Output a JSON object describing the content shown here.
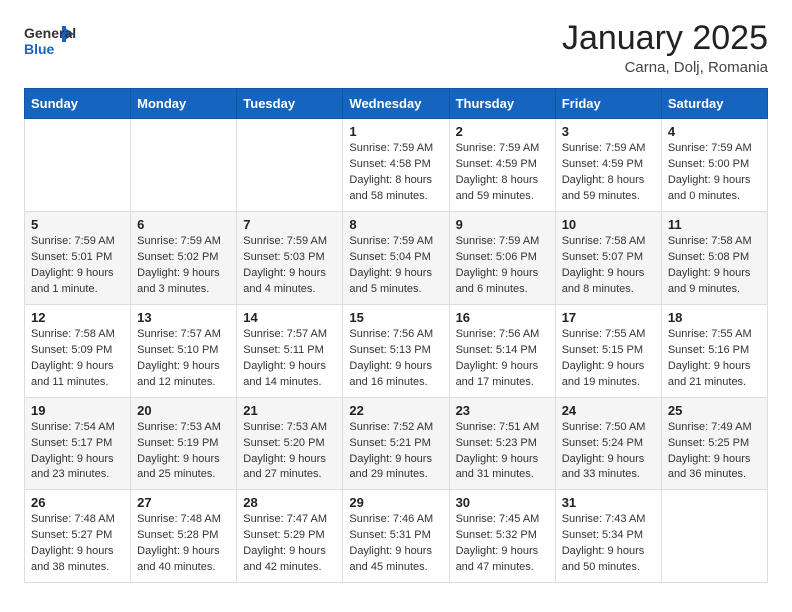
{
  "header": {
    "logo_general": "General",
    "logo_blue": "Blue",
    "month_year": "January 2025",
    "location": "Carna, Dolj, Romania"
  },
  "weekdays": [
    "Sunday",
    "Monday",
    "Tuesday",
    "Wednesday",
    "Thursday",
    "Friday",
    "Saturday"
  ],
  "weeks": [
    [
      {
        "day": "",
        "lines": []
      },
      {
        "day": "",
        "lines": []
      },
      {
        "day": "",
        "lines": []
      },
      {
        "day": "1",
        "lines": [
          "Sunrise: 7:59 AM",
          "Sunset: 4:58 PM",
          "Daylight: 8 hours",
          "and 58 minutes."
        ]
      },
      {
        "day": "2",
        "lines": [
          "Sunrise: 7:59 AM",
          "Sunset: 4:59 PM",
          "Daylight: 8 hours",
          "and 59 minutes."
        ]
      },
      {
        "day": "3",
        "lines": [
          "Sunrise: 7:59 AM",
          "Sunset: 4:59 PM",
          "Daylight: 8 hours",
          "and 59 minutes."
        ]
      },
      {
        "day": "4",
        "lines": [
          "Sunrise: 7:59 AM",
          "Sunset: 5:00 PM",
          "Daylight: 9 hours",
          "and 0 minutes."
        ]
      }
    ],
    [
      {
        "day": "5",
        "lines": [
          "Sunrise: 7:59 AM",
          "Sunset: 5:01 PM",
          "Daylight: 9 hours",
          "and 1 minute."
        ]
      },
      {
        "day": "6",
        "lines": [
          "Sunrise: 7:59 AM",
          "Sunset: 5:02 PM",
          "Daylight: 9 hours",
          "and 3 minutes."
        ]
      },
      {
        "day": "7",
        "lines": [
          "Sunrise: 7:59 AM",
          "Sunset: 5:03 PM",
          "Daylight: 9 hours",
          "and 4 minutes."
        ]
      },
      {
        "day": "8",
        "lines": [
          "Sunrise: 7:59 AM",
          "Sunset: 5:04 PM",
          "Daylight: 9 hours",
          "and 5 minutes."
        ]
      },
      {
        "day": "9",
        "lines": [
          "Sunrise: 7:59 AM",
          "Sunset: 5:06 PM",
          "Daylight: 9 hours",
          "and 6 minutes."
        ]
      },
      {
        "day": "10",
        "lines": [
          "Sunrise: 7:58 AM",
          "Sunset: 5:07 PM",
          "Daylight: 9 hours",
          "and 8 minutes."
        ]
      },
      {
        "day": "11",
        "lines": [
          "Sunrise: 7:58 AM",
          "Sunset: 5:08 PM",
          "Daylight: 9 hours",
          "and 9 minutes."
        ]
      }
    ],
    [
      {
        "day": "12",
        "lines": [
          "Sunrise: 7:58 AM",
          "Sunset: 5:09 PM",
          "Daylight: 9 hours",
          "and 11 minutes."
        ]
      },
      {
        "day": "13",
        "lines": [
          "Sunrise: 7:57 AM",
          "Sunset: 5:10 PM",
          "Daylight: 9 hours",
          "and 12 minutes."
        ]
      },
      {
        "day": "14",
        "lines": [
          "Sunrise: 7:57 AM",
          "Sunset: 5:11 PM",
          "Daylight: 9 hours",
          "and 14 minutes."
        ]
      },
      {
        "day": "15",
        "lines": [
          "Sunrise: 7:56 AM",
          "Sunset: 5:13 PM",
          "Daylight: 9 hours",
          "and 16 minutes."
        ]
      },
      {
        "day": "16",
        "lines": [
          "Sunrise: 7:56 AM",
          "Sunset: 5:14 PM",
          "Daylight: 9 hours",
          "and 17 minutes."
        ]
      },
      {
        "day": "17",
        "lines": [
          "Sunrise: 7:55 AM",
          "Sunset: 5:15 PM",
          "Daylight: 9 hours",
          "and 19 minutes."
        ]
      },
      {
        "day": "18",
        "lines": [
          "Sunrise: 7:55 AM",
          "Sunset: 5:16 PM",
          "Daylight: 9 hours",
          "and 21 minutes."
        ]
      }
    ],
    [
      {
        "day": "19",
        "lines": [
          "Sunrise: 7:54 AM",
          "Sunset: 5:17 PM",
          "Daylight: 9 hours",
          "and 23 minutes."
        ]
      },
      {
        "day": "20",
        "lines": [
          "Sunrise: 7:53 AM",
          "Sunset: 5:19 PM",
          "Daylight: 9 hours",
          "and 25 minutes."
        ]
      },
      {
        "day": "21",
        "lines": [
          "Sunrise: 7:53 AM",
          "Sunset: 5:20 PM",
          "Daylight: 9 hours",
          "and 27 minutes."
        ]
      },
      {
        "day": "22",
        "lines": [
          "Sunrise: 7:52 AM",
          "Sunset: 5:21 PM",
          "Daylight: 9 hours",
          "and 29 minutes."
        ]
      },
      {
        "day": "23",
        "lines": [
          "Sunrise: 7:51 AM",
          "Sunset: 5:23 PM",
          "Daylight: 9 hours",
          "and 31 minutes."
        ]
      },
      {
        "day": "24",
        "lines": [
          "Sunrise: 7:50 AM",
          "Sunset: 5:24 PM",
          "Daylight: 9 hours",
          "and 33 minutes."
        ]
      },
      {
        "day": "25",
        "lines": [
          "Sunrise: 7:49 AM",
          "Sunset: 5:25 PM",
          "Daylight: 9 hours",
          "and 36 minutes."
        ]
      }
    ],
    [
      {
        "day": "26",
        "lines": [
          "Sunrise: 7:48 AM",
          "Sunset: 5:27 PM",
          "Daylight: 9 hours",
          "and 38 minutes."
        ]
      },
      {
        "day": "27",
        "lines": [
          "Sunrise: 7:48 AM",
          "Sunset: 5:28 PM",
          "Daylight: 9 hours",
          "and 40 minutes."
        ]
      },
      {
        "day": "28",
        "lines": [
          "Sunrise: 7:47 AM",
          "Sunset: 5:29 PM",
          "Daylight: 9 hours",
          "and 42 minutes."
        ]
      },
      {
        "day": "29",
        "lines": [
          "Sunrise: 7:46 AM",
          "Sunset: 5:31 PM",
          "Daylight: 9 hours",
          "and 45 minutes."
        ]
      },
      {
        "day": "30",
        "lines": [
          "Sunrise: 7:45 AM",
          "Sunset: 5:32 PM",
          "Daylight: 9 hours",
          "and 47 minutes."
        ]
      },
      {
        "day": "31",
        "lines": [
          "Sunrise: 7:43 AM",
          "Sunset: 5:34 PM",
          "Daylight: 9 hours",
          "and 50 minutes."
        ]
      },
      {
        "day": "",
        "lines": []
      }
    ]
  ]
}
